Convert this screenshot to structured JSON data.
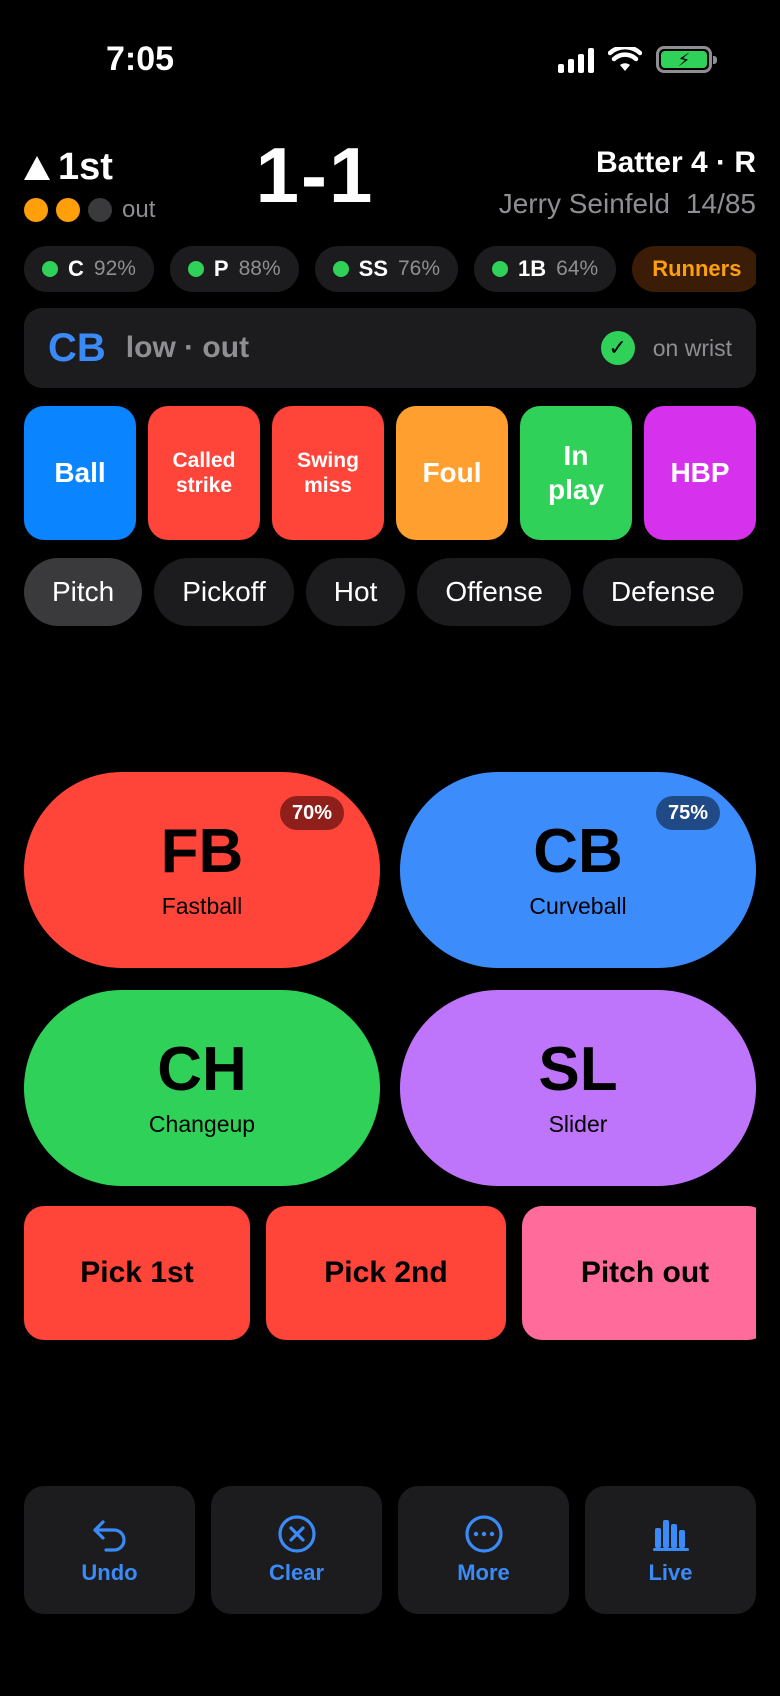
{
  "status_bar": {
    "time": "7:05"
  },
  "scoreboard": {
    "inning": "1st",
    "outs_label": "out",
    "outs": [
      {
        "color": "#ff9f0a"
      },
      {
        "color": "#ff9f0a"
      },
      {
        "color": "#3a3a3c"
      }
    ],
    "count": "1-1",
    "batter_line": "Batter 4 · R",
    "batter_name": "Jerry Seinfeld",
    "pitch_count": "14/85"
  },
  "fielders": [
    {
      "pos": "C",
      "pct": "92%"
    },
    {
      "pos": "P",
      "pct": "88%"
    },
    {
      "pos": "SS",
      "pct": "76%"
    },
    {
      "pos": "1B",
      "pct": "64%"
    }
  ],
  "runners_label": "Runners",
  "current_call": {
    "code": "CB",
    "desc": "low · out",
    "status": "on wrist"
  },
  "outcomes": [
    {
      "label": "Ball",
      "color": "#0a84ff"
    },
    {
      "label": "Called\nstrike",
      "color": "#ff453a"
    },
    {
      "label": "Swing\nmiss",
      "color": "#ff453a"
    },
    {
      "label": "Foul",
      "color": "#ff9f30"
    },
    {
      "label": "In\nplay",
      "color": "#30d158"
    },
    {
      "label": "HBP",
      "color": "#d632ed"
    }
  ],
  "tabs": [
    {
      "label": "Pitch",
      "active": true
    },
    {
      "label": "Pickoff"
    },
    {
      "label": "Hot"
    },
    {
      "label": "Offense"
    },
    {
      "label": "Defense"
    }
  ],
  "pitches": [
    {
      "code": "FB",
      "name": "Fastball",
      "badge": "70%",
      "color": "#ff453a",
      "badge_bg": "#8e1f1a"
    },
    {
      "code": "CB",
      "name": "Curveball",
      "badge": "75%",
      "color": "#3c8cfb",
      "badge_bg": "#1f4a86"
    },
    {
      "code": "CH",
      "name": "Changeup",
      "color": "#30d158"
    },
    {
      "code": "SL",
      "name": "Slider",
      "color": "#bf74fc"
    }
  ],
  "actions": [
    {
      "label": "Pick 1st",
      "color": "#ff453a"
    },
    {
      "label": "Pick 2nd",
      "color": "#ff453a"
    },
    {
      "label": "Pitch out",
      "color": "#ff6b9a"
    }
  ],
  "toolbar": {
    "undo": "Undo",
    "clear": "Clear",
    "more": "More",
    "live": "Live"
  }
}
